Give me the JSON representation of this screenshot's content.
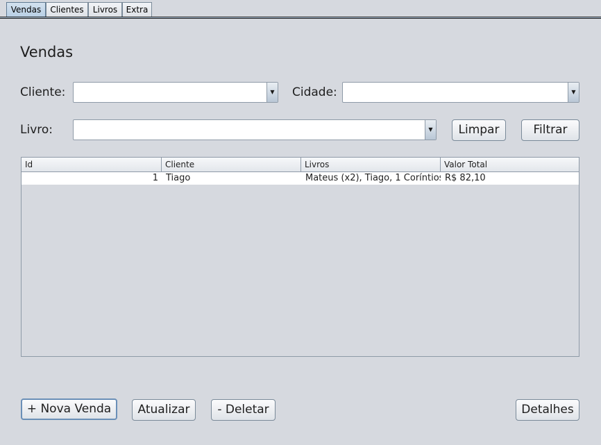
{
  "tabs": [
    {
      "label": "Vendas"
    },
    {
      "label": "Clientes"
    },
    {
      "label": "Livros"
    },
    {
      "label": "Extra"
    }
  ],
  "title": "Vendas",
  "filters": {
    "cliente_label": "Cliente:",
    "cidade_label": "Cidade:",
    "livro_label": "Livro:",
    "cliente_value": "",
    "cidade_value": "",
    "livro_value": "",
    "limpar_label": "Limpar",
    "filtrar_label": "Filtrar"
  },
  "table": {
    "columns": [
      "Id",
      "Cliente",
      "Livros",
      "Valor Total"
    ],
    "rows": [
      [
        "1",
        "Tiago",
        "Mateus (x2), Tiago, 1 Coríntios",
        "R$ 82,10"
      ]
    ]
  },
  "actions": {
    "nova_venda_label": "+ Nova Venda",
    "atualizar_label": "Atualizar",
    "deletar_label": "- Deletar",
    "detalhes_label": "Detalhes"
  }
}
